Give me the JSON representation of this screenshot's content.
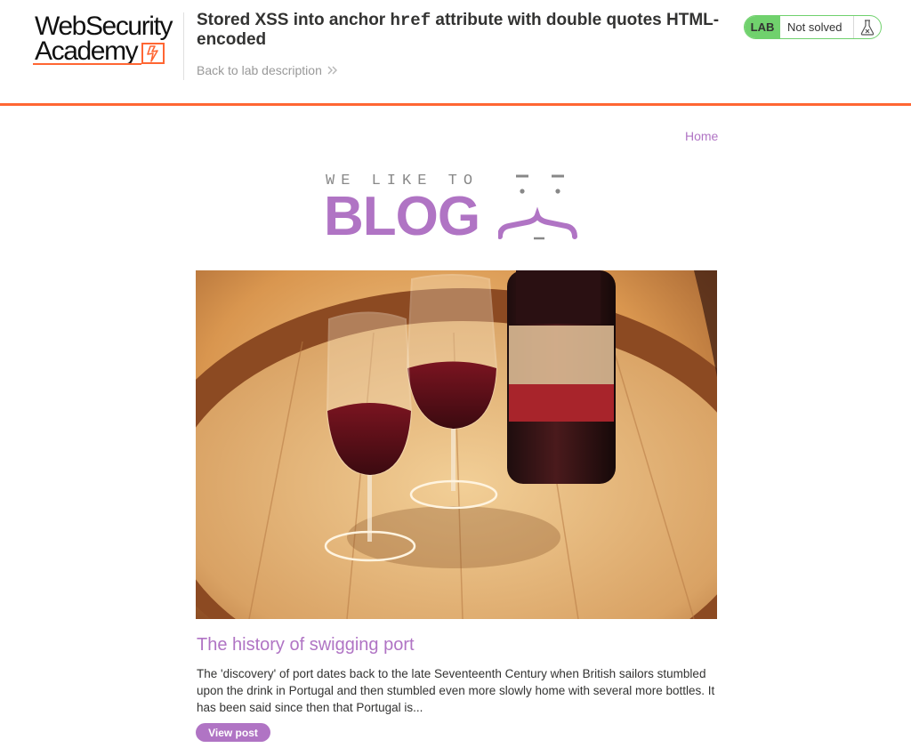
{
  "academy_header": {
    "logo_line1": "WebSecurity",
    "logo_line2": "Academy",
    "lab_title_part1": "Stored XSS into anchor ",
    "lab_title_code": "href",
    "lab_title_part2": " attribute with double quotes HTML-encoded",
    "back_link": "Back to lab description",
    "lab_tag": "LAB",
    "lab_status": "Not solved"
  },
  "blog": {
    "nav": {
      "home": "Home"
    },
    "logo_tagline": "WE LIKE TO",
    "logo_word": "BLOG",
    "posts": [
      {
        "title": "The history of swigging port",
        "summary": "The 'discovery' of port dates back to the late Seventeenth Century when British sailors stumbled upon the drink in Portugal and then stumbled even more slowly home with several more bottles. It has been said since then that Portugal is...",
        "button_label": "View post"
      }
    ]
  },
  "colors": {
    "accent_orange": "#ff6633",
    "blog_purple": "#b074c4",
    "status_green": "#70d16d"
  },
  "icons": [
    "lightning-bolt-icon",
    "chevron-right-icon",
    "flask-icon",
    "blog-face-icon"
  ]
}
